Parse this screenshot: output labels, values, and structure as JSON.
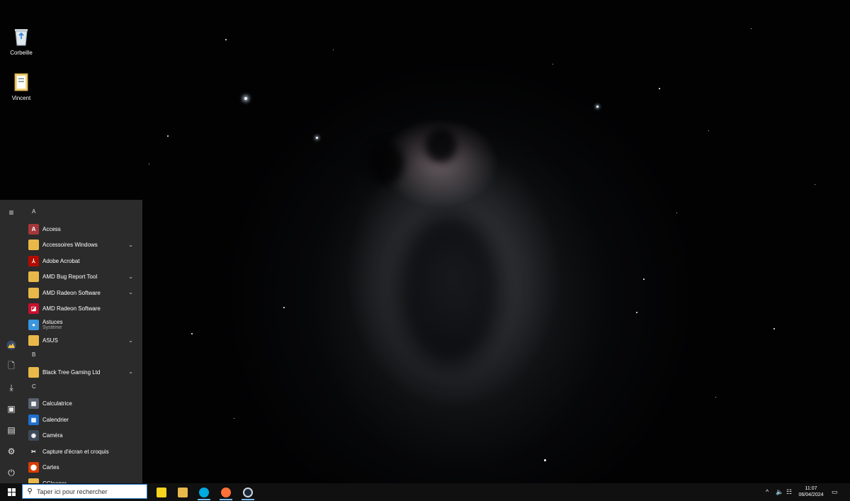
{
  "desktop": {
    "icons": [
      {
        "label": "Corbeille",
        "icon": "recycle-bin-icon"
      },
      {
        "label": "Vincent",
        "icon": "user-folder-icon"
      }
    ]
  },
  "start_menu": {
    "rail": [
      {
        "icon": "hamburger-menu-icon",
        "glyph": "≡"
      },
      {
        "icon": "user-avatar-icon",
        "glyph": ""
      },
      {
        "icon": "documents-icon",
        "glyph": "🗋"
      },
      {
        "icon": "downloads-icon",
        "glyph": "⤓"
      },
      {
        "icon": "pictures-icon",
        "glyph": "▣"
      },
      {
        "icon": "videos-icon",
        "glyph": "▤"
      },
      {
        "icon": "settings-gear-icon",
        "glyph": "⚙"
      },
      {
        "icon": "power-icon",
        "glyph": "⏻"
      }
    ],
    "sections": [
      {
        "letter": "A",
        "items": [
          {
            "label": "Access",
            "icon": "access-icon",
            "color": "#a4373a",
            "glyph": "A",
            "expandable": false
          },
          {
            "label": "Accessoires Windows",
            "icon": "folder-icon",
            "expandable": true
          },
          {
            "label": "Adobe Acrobat",
            "icon": "adobe-acrobat-icon",
            "color": "#b30b00",
            "glyph": "⅄",
            "expandable": false
          },
          {
            "label": "AMD Bug Report Tool",
            "icon": "folder-icon",
            "expandable": true
          },
          {
            "label": "AMD Radeon Software",
            "icon": "folder-icon",
            "expandable": true
          },
          {
            "label": "AMD Radeon Software",
            "icon": "amd-radeon-icon",
            "color": "#c8102e",
            "glyph": "◪",
            "expandable": false
          },
          {
            "label": "Astuces",
            "sublabel": "Système",
            "icon": "tips-lightbulb-icon",
            "color": "#3a96dd",
            "glyph": "●",
            "expandable": false
          },
          {
            "label": "ASUS",
            "icon": "folder-icon",
            "expandable": true
          }
        ]
      },
      {
        "letter": "B",
        "items": [
          {
            "label": "Black Tree Gaming Ltd",
            "icon": "folder-icon",
            "expandable": true
          }
        ]
      },
      {
        "letter": "C",
        "items": [
          {
            "label": "Calculatrice",
            "icon": "calculator-icon",
            "color": "#5a6470",
            "glyph": "▦",
            "expandable": false
          },
          {
            "label": "Calendrier",
            "icon": "calendar-icon",
            "color": "#1e6fd0",
            "glyph": "▦",
            "expandable": false
          },
          {
            "label": "Caméra",
            "icon": "camera-icon",
            "color": "#3d4a5a",
            "glyph": "◉",
            "expandable": false
          },
          {
            "label": "Capture d'écran et croquis",
            "icon": "snip-sketch-icon",
            "color": "#2a2a2a",
            "glyph": "✂",
            "expandable": false
          },
          {
            "label": "Cartes",
            "icon": "maps-pin-icon",
            "color": "#d83b01",
            "glyph": "⬤",
            "expandable": false
          },
          {
            "label": "CCleaner",
            "icon": "folder-icon",
            "expandable": true
          }
        ]
      }
    ]
  },
  "taskbar": {
    "search_placeholder": "Taper ici pour rechercher",
    "apps": [
      {
        "name": "sticky-notes",
        "icon": "sticky-notes-icon",
        "color": "#f7d41e",
        "running": false
      },
      {
        "name": "file-explorer",
        "icon": "file-explorer-folder-icon",
        "color": "#e8b84a",
        "running": false
      },
      {
        "name": "skype",
        "icon": "skype-icon",
        "color": "#00a9e0",
        "running": true
      },
      {
        "name": "firefox",
        "icon": "firefox-icon",
        "color": "#ff7139",
        "running": true
      },
      {
        "name": "steam",
        "icon": "steam-icon",
        "color": "#1b2838",
        "running": true
      }
    ],
    "tray": {
      "time": "11:07",
      "date": "06/04/2024"
    }
  }
}
